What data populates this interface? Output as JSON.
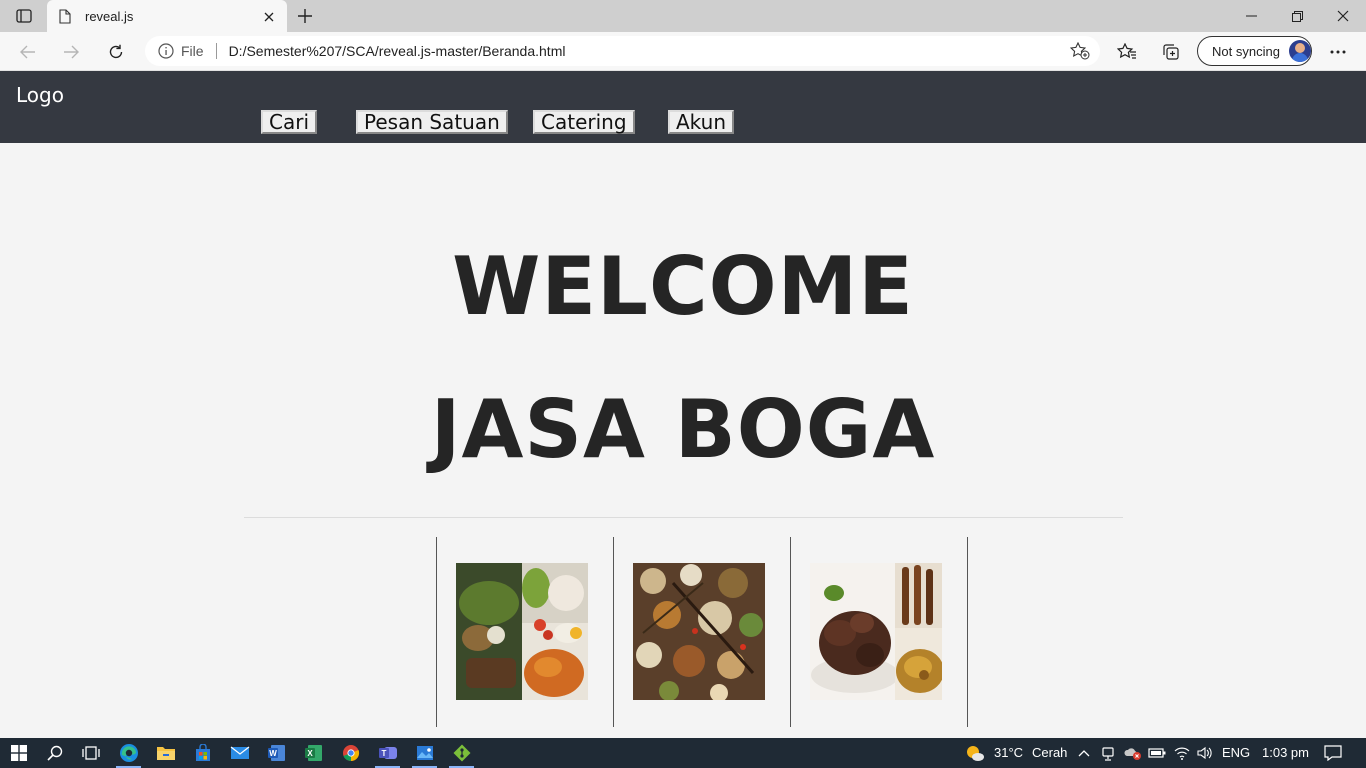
{
  "browser": {
    "tab_title": "reveal.js",
    "url_scheme": "File",
    "url": "D:/Semester%207/SCA/reveal.js-master/Beranda.html",
    "profile_label": "Not syncing"
  },
  "site": {
    "logo": "Logo",
    "nav": [
      "Cari",
      "Pesan Satuan",
      "Catering",
      "Akun"
    ],
    "hero_line1": "WELCOME",
    "hero_line2": "JASA BOGA",
    "gallery_images": [
      "food-photo-1",
      "food-photo-2",
      "food-photo-3"
    ]
  },
  "taskbar": {
    "weather_temp": "31°C",
    "weather_desc": "Cerah",
    "language": "ENG",
    "time": "1:03 pm",
    "apps": [
      "start",
      "search",
      "task-view",
      "edge",
      "file-explorer",
      "store",
      "mail",
      "word",
      "excel",
      "chrome",
      "teams",
      "photos",
      "git"
    ]
  },
  "colors": {
    "page_header_bg": "#353941",
    "page_bg": "#f4f4f4",
    "heading": "#252525",
    "taskbar_bg": "#1f2a35"
  }
}
